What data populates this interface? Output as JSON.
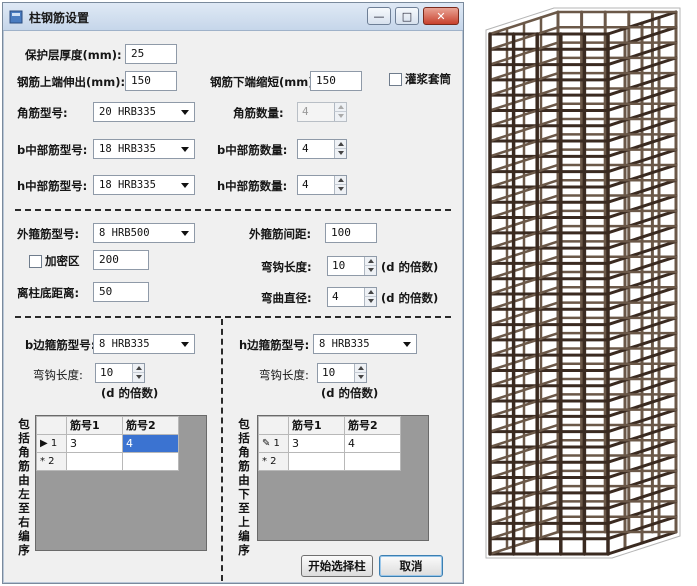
{
  "window": {
    "title": "柱钢筋设置",
    "minimize_glyph": "—",
    "maximize_glyph": "□",
    "close_glyph": "✕"
  },
  "top": {
    "cover_label": "保护层厚度(mm):",
    "cover_value": "25",
    "top_ext_label": "钢筋上端伸出(mm):",
    "top_ext_value": "150",
    "bottom_short_label": "钢筋下端缩短(mm):",
    "bottom_short_value": "150",
    "grout_sleeve_label": "灌浆套筒",
    "corner_type_label": "角筋型号:",
    "corner_type_value": "20 HRB335",
    "corner_count_label": "角筋数量:",
    "corner_count_value": "4",
    "b_mid_type_label": "b中部筋型号:",
    "b_mid_type_value": "18 HRB335",
    "b_mid_count_label": "b中部筋数量:",
    "b_mid_count_value": "4",
    "h_mid_type_label": "h中部筋型号:",
    "h_mid_type_value": "18 HRB335",
    "h_mid_count_label": "h中部筋数量:",
    "h_mid_count_value": "4"
  },
  "stirrup": {
    "outer_type_label": "外箍筋型号:",
    "outer_type_value": "8 HRB500",
    "outer_spacing_label": "外箍筋间距:",
    "outer_spacing_value": "100",
    "dense_zone_label": "加密区",
    "dense_zone_value": "200",
    "hook_len_label": "弯钩长度:",
    "hook_len_value": "10",
    "d_multiple_label": "(d 的倍数)",
    "base_dist_label": "离柱底距离:",
    "base_dist_value": "50",
    "bend_diam_label": "弯曲直径:",
    "bend_diam_value": "4",
    "bend_d_multiple_label": "(d 的倍数)"
  },
  "left_panel": {
    "type_label": "b边箍筋型号:",
    "type_value": "8 HRB335",
    "hook_label": "弯钩长度:",
    "hook_value": "10",
    "d_multiple_label": "(d 的倍数)",
    "vertical_label": "包括角筋由左至右编序",
    "grid": {
      "headers": [
        "筋号1",
        "筋号2"
      ],
      "rows": [
        {
          "marker": "▶ 1",
          "cells": [
            "3",
            "4"
          ]
        },
        {
          "marker": "* 2",
          "cells": [
            "",
            ""
          ]
        }
      ]
    }
  },
  "right_panel": {
    "type_label": "h边箍筋型号:",
    "type_value": "8 HRB335",
    "hook_label": "弯钩长度:",
    "hook_value": "10",
    "d_multiple_label": "(d 的倍数)",
    "vertical_label": "包括角筋由下至上编序",
    "grid": {
      "headers": [
        "筋号1",
        "筋号2"
      ],
      "rows": [
        {
          "marker": "✎ 1",
          "cells": [
            "3",
            "4"
          ]
        },
        {
          "marker": "* 2",
          "cells": [
            "",
            ""
          ]
        }
      ]
    }
  },
  "actions": {
    "start_label": "开始选择柱",
    "cancel_label": "取消"
  },
  "colors": {
    "rebar": "#3a2a20",
    "rebar_light": "#6b5848",
    "selection": "#3b73d1"
  }
}
